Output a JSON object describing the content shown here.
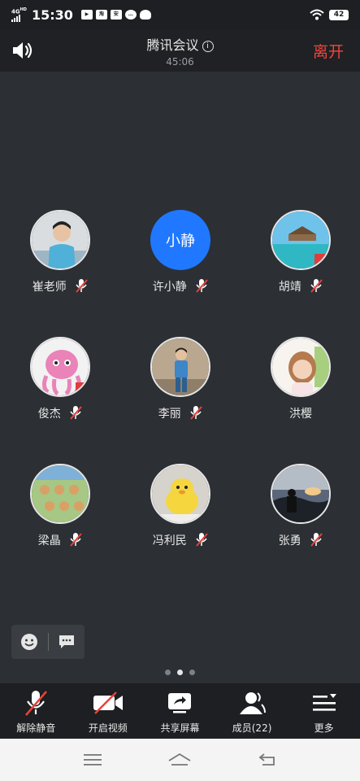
{
  "status_bar": {
    "network": "4G",
    "network_hd": "HD",
    "time": "15:30",
    "battery": "42",
    "app_icons": [
      "youku-icon",
      "taobao-icon",
      "security-icon",
      "message-icon",
      "qq-icon"
    ]
  },
  "header": {
    "title": "腾讯会议",
    "timer": "45:06",
    "leave_label": "离开"
  },
  "participants": [
    {
      "name": "崔老师",
      "avatar": "photo",
      "muted": true
    },
    {
      "name": "许小静",
      "avatar": "text",
      "avatar_text": "小静",
      "muted": true
    },
    {
      "name": "胡靖",
      "avatar": "photo",
      "muted": true
    },
    {
      "name": "俊杰",
      "avatar": "photo",
      "muted": true
    },
    {
      "name": "李丽",
      "avatar": "photo",
      "muted": true
    },
    {
      "name": "洪樱",
      "avatar": "photo",
      "muted": false
    },
    {
      "name": "梁晶",
      "avatar": "photo",
      "muted": true
    },
    {
      "name": "冯利民",
      "avatar": "photo",
      "muted": true
    },
    {
      "name": "张勇",
      "avatar": "photo",
      "muted": true
    }
  ],
  "pagination": {
    "pages": 3,
    "current": 2
  },
  "toolbar": {
    "unmute_label": "解除静音",
    "video_label": "开启视频",
    "share_label": "共享屏幕",
    "members_label": "成员(22)",
    "more_label": "更多"
  },
  "colors": {
    "accent": "#1f78ff",
    "leave": "#f0463c",
    "mute_slash": "#e8423b",
    "background": "#2c2f34"
  }
}
